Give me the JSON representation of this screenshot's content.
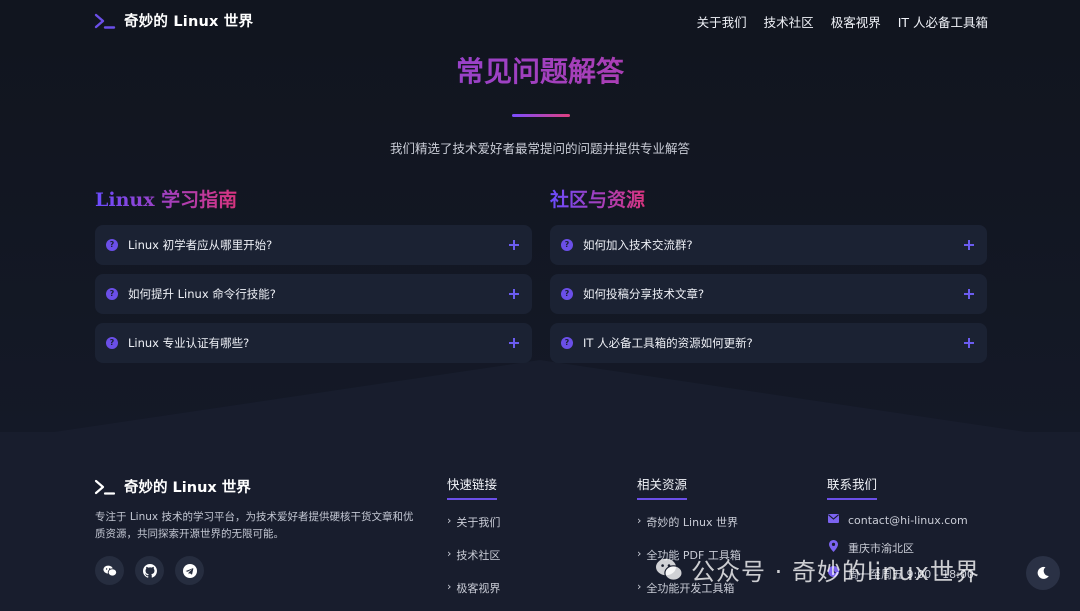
{
  "nav": {
    "brand": "奇妙的 Linux 世界",
    "links": [
      "关于我们",
      "技术社区",
      "极客视界",
      "IT 人必备工具箱"
    ]
  },
  "faq": {
    "title": "常见问题解答",
    "subtitle": "我们精选了技术爱好者最常提问的问题并提供专业解答",
    "left": {
      "title": "Linux 学习指南",
      "items": [
        "Linux 初学者应从哪里开始?",
        "如何提升 Linux 命令行技能?",
        "Linux 专业认证有哪些?"
      ]
    },
    "right": {
      "title": "社区与资源",
      "items": [
        "如何加入技术交流群?",
        "如何投稿分享技术文章?",
        "IT 人必备工具箱的资源如何更新?"
      ]
    }
  },
  "footer": {
    "brand": "奇妙的 Linux 世界",
    "description": "专注于 Linux 技术的学习平台，为技术爱好者提供硬核干货文章和优质资源，共同探索开源世界的无限可能。",
    "quick_links": {
      "title": "快速链接",
      "items": [
        "关于我们",
        "技术社区",
        "极客视界"
      ]
    },
    "resources": {
      "title": "相关资源",
      "items": [
        "奇妙的 Linux 世界",
        "全功能 PDF 工具箱",
        "全功能开发工具箱"
      ]
    },
    "contact": {
      "title": "联系我们",
      "email": "contact@hi-linux.com",
      "address": "重庆市渝北区",
      "hours": "周一至周五 9:00 - 18:00"
    }
  },
  "watermark": "公众号 · 奇妙的linux世界",
  "colors": {
    "accent": "#6b4fe8",
    "gradient_end": "#d9347e",
    "background": "#151a2b"
  }
}
